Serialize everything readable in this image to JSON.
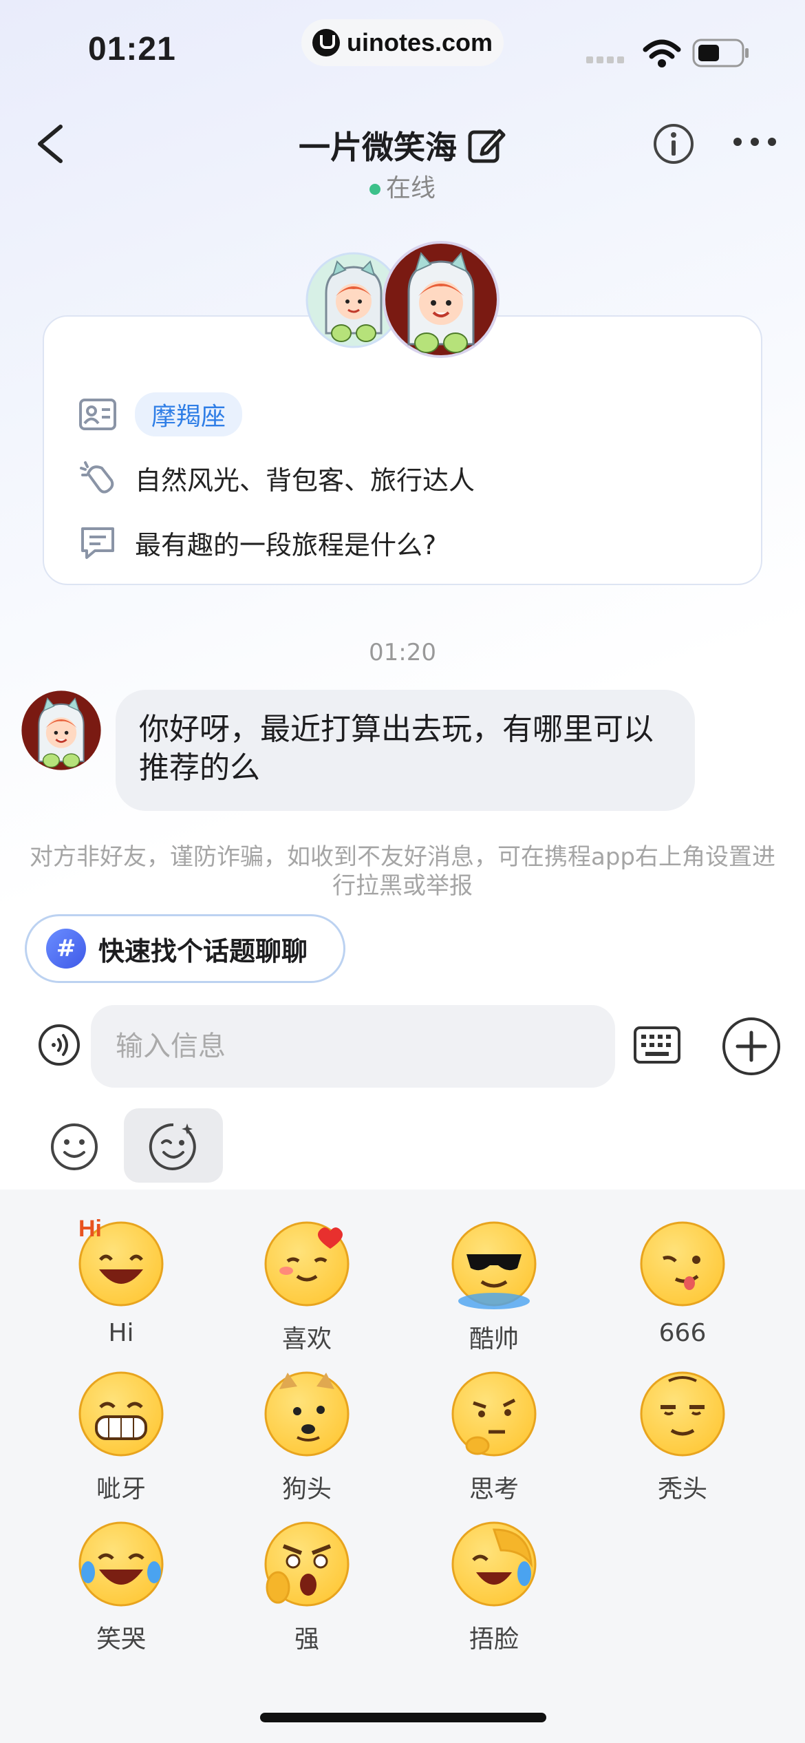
{
  "status_bar": {
    "time": "01:21",
    "watermark": "uinotes.com"
  },
  "nav": {
    "title": "一片微笑海",
    "status": "在线"
  },
  "profile_card": {
    "zodiac_tag": "摩羯座",
    "interests": "自然风光、背包客、旅行达人",
    "question": "最有趣的一段旅程是什么?"
  },
  "chat": {
    "timestamp": "01:20",
    "message": "你好呀，最近打算出去玩，有哪里可以推荐的么",
    "warning": "对方非好友，谨防诈骗，如收到不友好消息，可在携程app右上角设置进行拉黑或举报",
    "topic_button": "快速找个话题聊聊"
  },
  "composer": {
    "placeholder": "输入信息"
  },
  "stickers": [
    {
      "label": "Hi",
      "icon": "hi-emoji"
    },
    {
      "label": "喜欢",
      "icon": "love-emoji"
    },
    {
      "label": "酷帅",
      "icon": "cool-emoji"
    },
    {
      "label": "666",
      "icon": "666-emoji"
    },
    {
      "label": "呲牙",
      "icon": "grin-emoji"
    },
    {
      "label": "狗头",
      "icon": "doge-emoji"
    },
    {
      "label": "思考",
      "icon": "think-emoji"
    },
    {
      "label": "秃头",
      "icon": "bald-emoji"
    },
    {
      "label": "笑哭",
      "icon": "tears-of-joy-emoji"
    },
    {
      "label": "强",
      "icon": "strong-emoji"
    },
    {
      "label": "捂脸",
      "icon": "facepalm-emoji"
    }
  ],
  "colors": {
    "accent_blue": "#2f7ee6",
    "online_green": "#3cc08a",
    "emoji_yellow": "#ffc93a"
  }
}
